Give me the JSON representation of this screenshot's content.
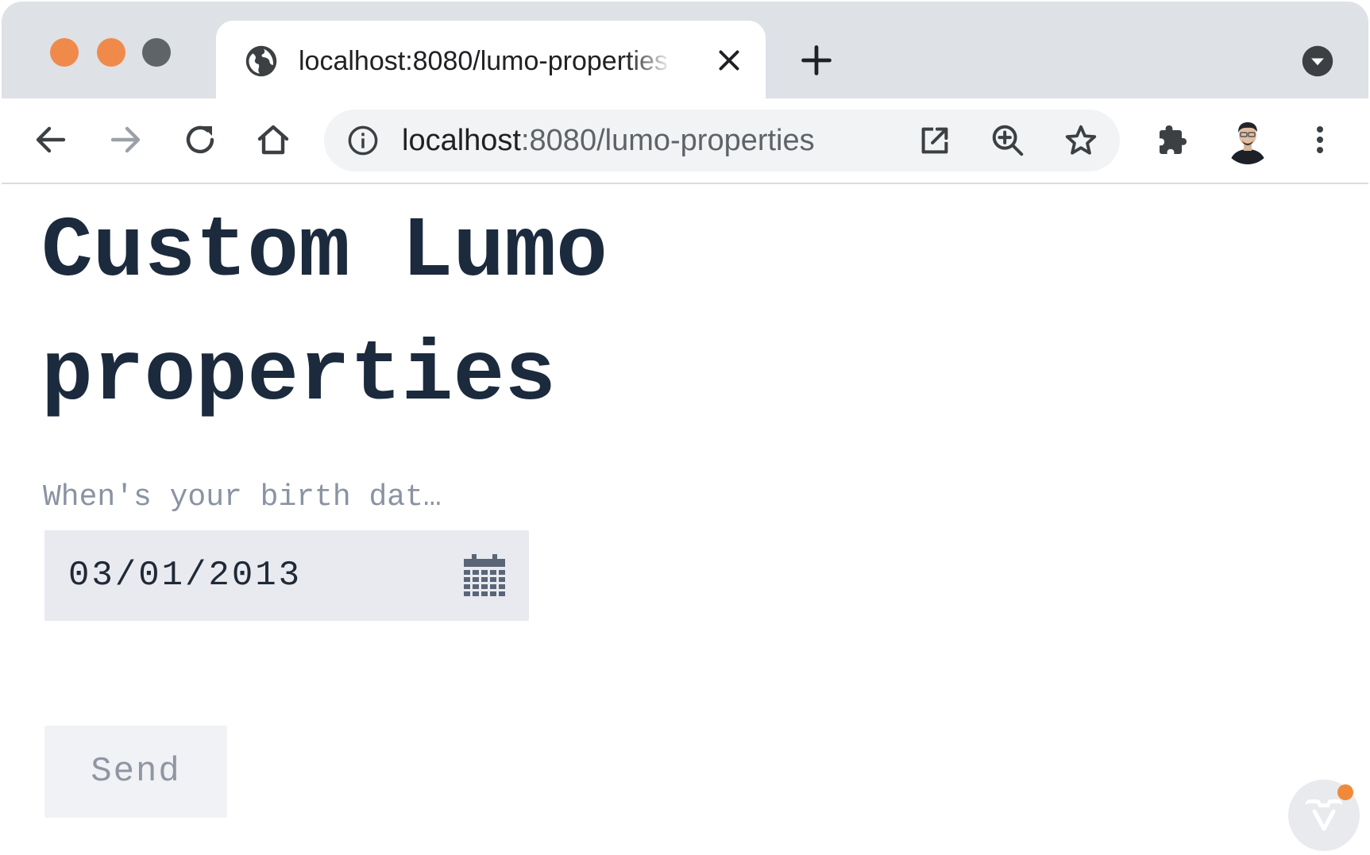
{
  "browser": {
    "tab": {
      "title": "localhost:8080/lumo-properties",
      "favicon": "globe-icon"
    },
    "address_bar": {
      "host": "localhost",
      "path": ":8080/lumo-properties"
    },
    "colors": {
      "close_dot": "#f08a4b",
      "minimize_dot": "#f08a4b",
      "maximize_dot": "#5f6468"
    }
  },
  "page": {
    "title": "Custom Lumo properties",
    "date_field": {
      "label": "When's your birth dat…",
      "value": "03/01/2013",
      "icon": "calendar-icon"
    },
    "send_button": {
      "label": "Send"
    },
    "dev_badge": {
      "icon": "vaadin-logo-icon",
      "accent": "#f08a3a"
    }
  }
}
